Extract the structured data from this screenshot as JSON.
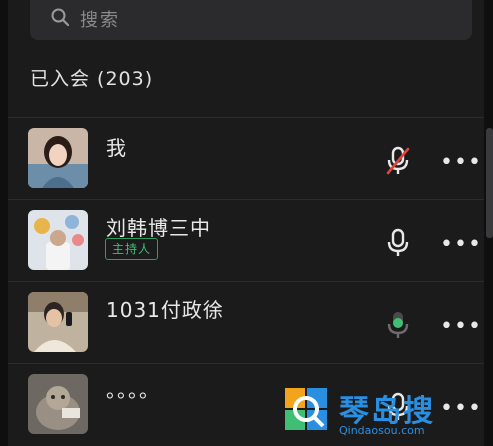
{
  "search": {
    "placeholder": "搜索",
    "icon": "search-icon"
  },
  "header": {
    "joined_label": "已入会 (203)"
  },
  "participants": [
    {
      "name": "我",
      "host_badge": "",
      "mic_state": "muted",
      "more": "•••"
    },
    {
      "name": "刘韩博三中",
      "host_badge": "主持人",
      "mic_state": "unmuted",
      "more": "•••"
    },
    {
      "name": "1031付政徐",
      "host_badge": "",
      "mic_state": "speaking",
      "more": "•••"
    },
    {
      "name": "。。。。",
      "host_badge": "",
      "mic_state": "unmuted",
      "more": "•••"
    }
  ],
  "watermark": {
    "title": "琴岛搜",
    "url": "Qindaosou.com"
  },
  "colors": {
    "background": "#1b1b1c",
    "muted_red": "#e0443e",
    "speaking_green": "#3fbf74",
    "host_badge_green": "#2f9c5e",
    "watermark_blue": "#2a8fe0"
  }
}
